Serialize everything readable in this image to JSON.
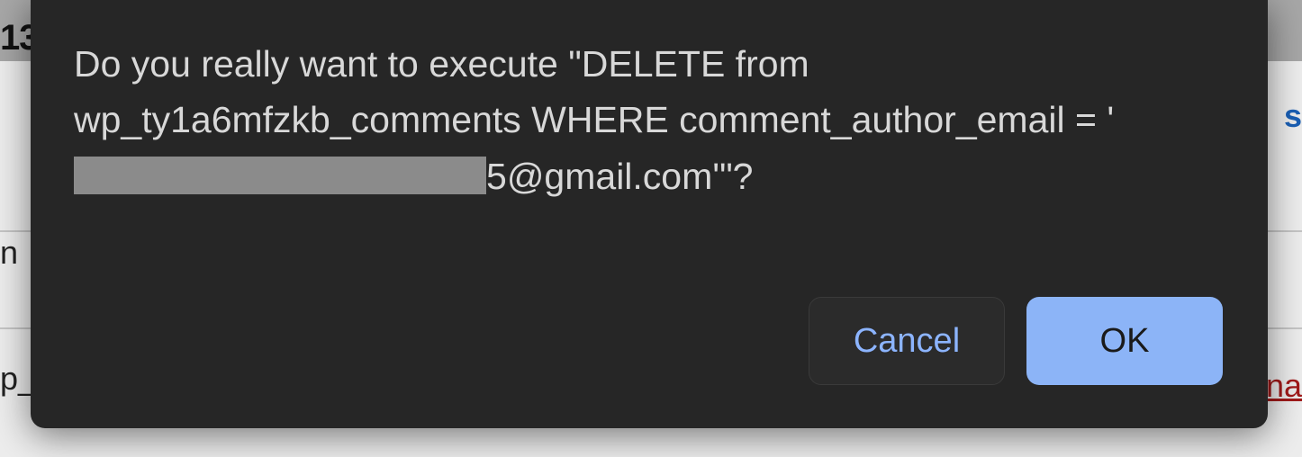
{
  "background": {
    "top_number": "13",
    "right_link": "s",
    "left_2": "n",
    "left_3": "p_",
    "right_3": "na"
  },
  "dialog": {
    "message_pre": "Do you really want to execute \"DELETE from wp_ty1a6mfzkb_comments WHERE comment_author_email = '",
    "redacted_tail": "5",
    "message_post": "@gmail.com'\"?",
    "cancel_label": "Cancel",
    "ok_label": "OK"
  }
}
